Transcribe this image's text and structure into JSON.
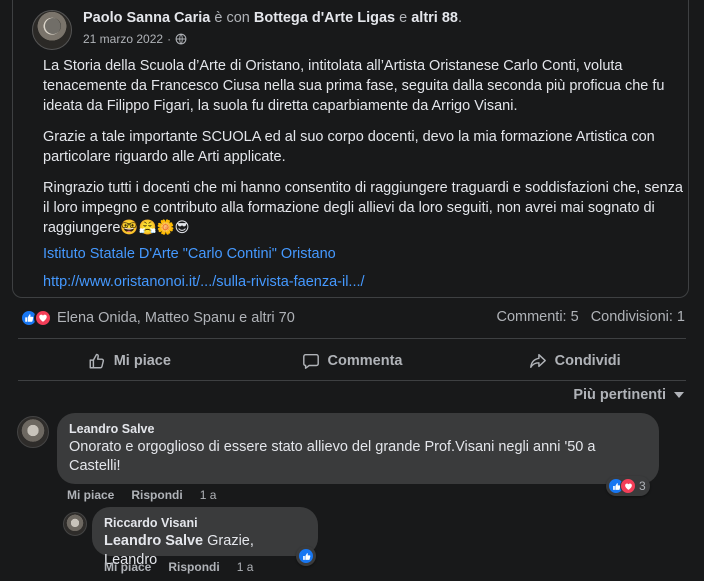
{
  "post": {
    "author": "Paolo Sanna Caria",
    "with_text": "è con",
    "tagged": "Bottega d'Arte Ligas",
    "and_text": "e",
    "others": "altri 88",
    "period": ".",
    "date": "21 marzo 2022",
    "sep": "·",
    "paragraphs": [
      "La Storia della Scuola d’Arte di Oristano, intitolata all’Artista Oristanese Carlo Conti, voluta tenacemente da Francesco Ciusa nella sua prima fase, seguita dalla seconda più proficua che fu ideata da Filippo Figari, la suola fu  diretta caparbiamente da Arrigo Visani.",
      "Grazie a tale importante SCUOLA ed al suo corpo docenti, devo la mia formazione Artistica con particolare riguardo alle Arti applicate.",
      "Ringrazio tutti i docenti che mi hanno consentito di raggiungere traguardi e soddisfazioni che, senza il loro impegno e contributo alla formazione degli allievi da loro seguiti, non avrei mai sognato di raggiungere🤓😤🌼😎"
    ],
    "link_1": "Istituto Statale D'Arte \"Carlo Contini\" Oristano",
    "link_2": "http://www.oristanonoi.it/.../sulla-rivista-faenza-il.../"
  },
  "stats": {
    "reactors": "Elena Onida, Matteo Spanu e altri 70",
    "comments": "Commenti: 5",
    "shares": "Condivisioni: 1"
  },
  "actions": {
    "like": "Mi piace",
    "comment": "Commenta",
    "share": "Condividi"
  },
  "sort_label": "Più pertinenti",
  "comments": [
    {
      "author": "Leandro Salve",
      "text": "Onorato e orgoglioso di essere stato allievo del grande Prof.Visani negli anni '50 a Castelli!",
      "like": "Mi piace",
      "reply": "Rispondi",
      "time": "1 a",
      "reaction_count": "3"
    },
    {
      "author": "Riccardo Visani",
      "mention": "Leandro Salve",
      "text": "Grazie, Leandro",
      "like": "Mi piace",
      "reply": "Rispondi",
      "time": "1 a"
    }
  ],
  "colors": {
    "like_blue": "#1877f2",
    "love_red": "#f33e58",
    "link_blue": "#4599ff"
  }
}
